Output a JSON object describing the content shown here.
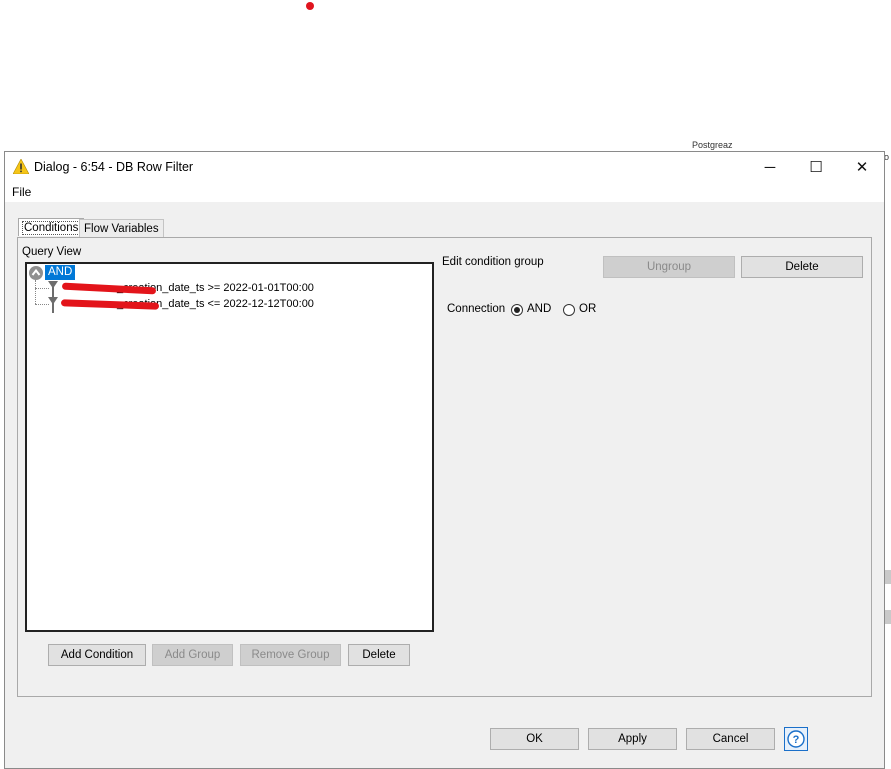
{
  "window": {
    "title": "Dialog - 6:54 - DB Row Filter"
  },
  "titlebar_buttons": {
    "minimize": "─",
    "maximize": "☐",
    "close": "✕"
  },
  "menu": {
    "file": "File"
  },
  "tabs": [
    {
      "label": "Conditions",
      "active": true
    },
    {
      "label": "Flow Variables",
      "active": false
    }
  ],
  "query_view": {
    "label": "Query View",
    "root_label": "AND",
    "conditions": [
      {
        "text": "_creation_date_ts >= 2022-01-01T00:00"
      },
      {
        "text": "_creation_date_ts <= 2022-12-12T00:00"
      }
    ]
  },
  "tree_buttons": {
    "add_condition": "Add Condition",
    "add_group": "Add Group",
    "remove_group": "Remove Group",
    "delete": "Delete"
  },
  "edit_group": {
    "title": "Edit condition group",
    "ungroup": "Ungroup",
    "delete": "Delete",
    "connection_label": "Connection",
    "options": [
      {
        "label": "AND",
        "selected": true
      },
      {
        "label": "OR",
        "selected": false
      }
    ]
  },
  "footer": {
    "ok": "OK",
    "apply": "Apply",
    "cancel": "Cancel",
    "help": "?"
  },
  "background": {
    "snippet1": "Postgreaz",
    "snippet2": "o"
  },
  "colors": {
    "selection": "#0078d7",
    "redaction": "#e3141a",
    "warning": "#f5c518"
  }
}
